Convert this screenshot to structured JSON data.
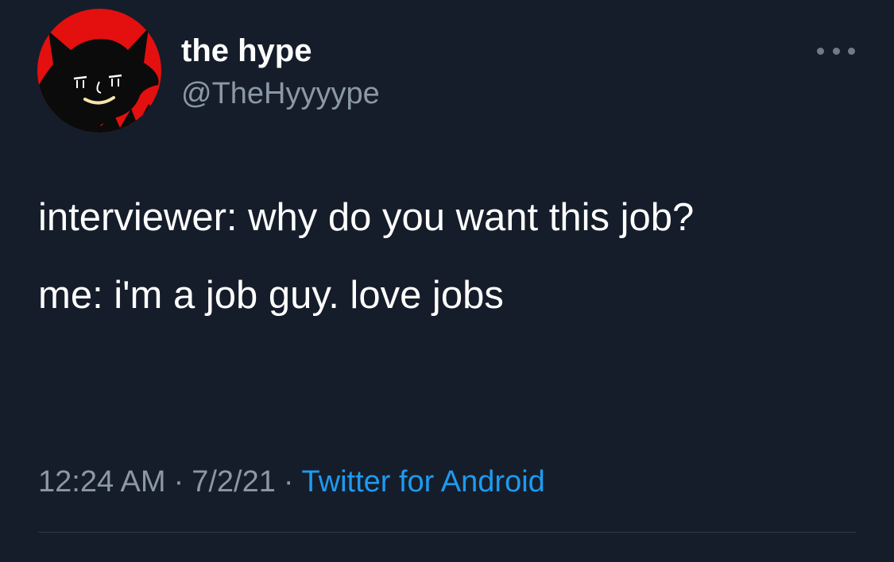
{
  "author": {
    "display_name": "the hype",
    "handle": "@TheHyyyype",
    "avatar_icon": "red-devil-avatar",
    "avatar_colors": {
      "background": "#e3100f",
      "figure": "#0b0b0b"
    }
  },
  "more_icon": "more-dots-icon",
  "tweet": {
    "line1": "interviewer: why do you want this job?",
    "line2": "me: i'm a job guy. love jobs"
  },
  "meta": {
    "time": "12:24 AM",
    "separator": "·",
    "date": "7/2/21",
    "source": "Twitter for Android"
  },
  "colors": {
    "background": "#161d2a",
    "text": "#ffffff",
    "muted": "#8b98a5",
    "link": "#1d9bf0"
  }
}
